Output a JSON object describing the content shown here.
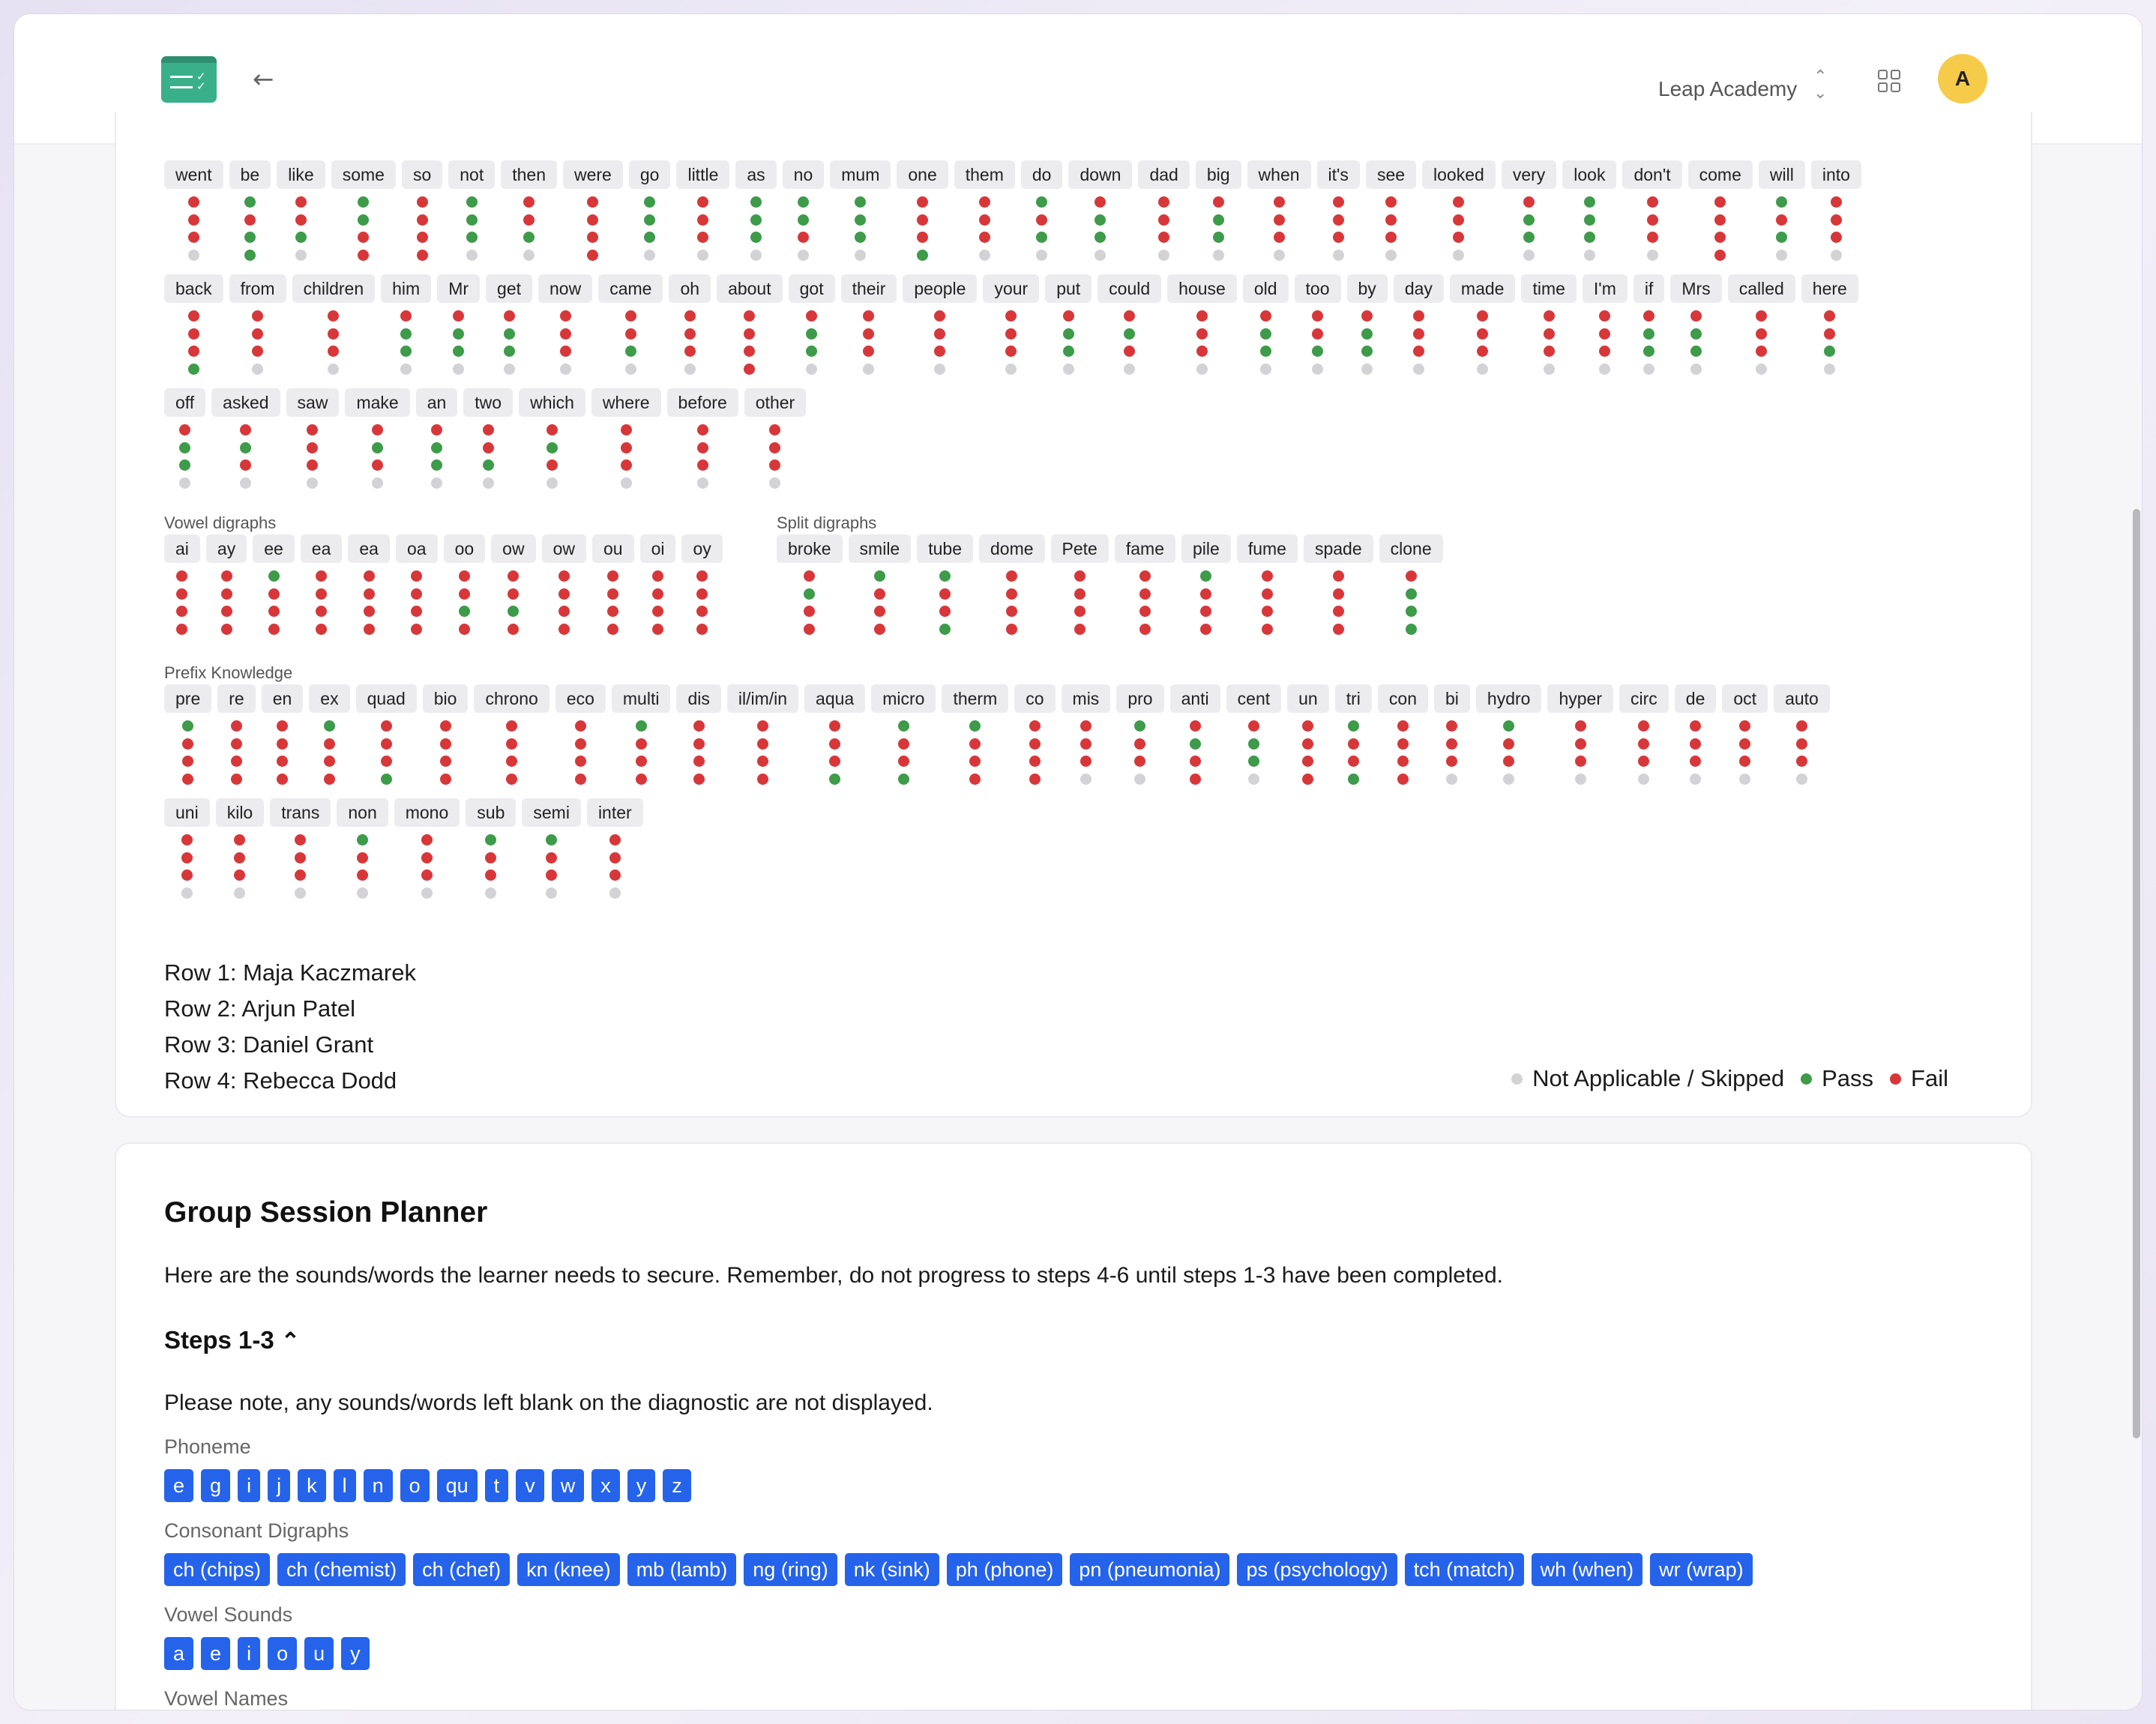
{
  "header": {
    "school_name": "Leap Academy",
    "avatar_initial": "A"
  },
  "keywords": {
    "rows": [
      {
        "words": [
          "went",
          "be",
          "like",
          "some",
          "so",
          "not",
          "then",
          "were",
          "go",
          "little",
          "as",
          "no",
          "mum",
          "one",
          "them",
          "do",
          "down",
          "dad",
          "big",
          "when",
          "it's",
          "see",
          "looked",
          "very",
          "look",
          "don't",
          "come",
          "will",
          "into"
        ],
        "results": [
          "FFFN",
          "PFPP",
          "FFPN",
          "PPFF",
          "FFFF",
          "PPPN",
          "FFPN",
          "FFFF",
          "PPPN",
          "FFFN",
          "PPPN",
          "PPFN",
          "PPPN",
          "FFFP",
          "FFFN",
          "PFPN",
          "FPPN",
          "FFFN",
          "FPPN",
          "FFFN",
          "FFFN",
          "FFFN",
          "FFFN",
          "FPPN",
          "PPPN",
          "FFFN",
          "FFFF",
          "PFPN",
          "FFFN"
        ]
      },
      {
        "words": [
          "back",
          "from",
          "children",
          "him",
          "Mr",
          "get",
          "now",
          "came",
          "oh",
          "about",
          "got",
          "their",
          "people",
          "your",
          "put",
          "could",
          "house",
          "old",
          "too",
          "by",
          "day",
          "made",
          "time",
          "I'm",
          "if",
          "Mrs",
          "called",
          "here"
        ],
        "results": [
          "FFFP",
          "FFFN",
          "FFFN",
          "FPPN",
          "FPPN",
          "FPPN",
          "FFFN",
          "FFPN",
          "FFFN",
          "FFFF",
          "FPPN",
          "FFFN",
          "FFFN",
          "FFFN",
          "FPPN",
          "FPFN",
          "FFFN",
          "FPPN",
          "FFPN",
          "FPPN",
          "FFFN",
          "FFFN",
          "FFFN",
          "FFFN",
          "FPPN",
          "FPPN",
          "FFFN",
          "FFPN"
        ]
      },
      {
        "words": [
          "off",
          "asked",
          "saw",
          "make",
          "an",
          "two",
          "which",
          "where",
          "before",
          "other"
        ],
        "results": [
          "FPPN",
          "FPFN",
          "FFFN",
          "FPFN",
          "FPPN",
          "FFPN",
          "FPFN",
          "FFFN",
          "FFFN",
          "FFFN"
        ]
      }
    ]
  },
  "vowel_digraphs": {
    "label": "Vowel digraphs",
    "words": [
      "ai",
      "ay",
      "ee",
      "ea",
      "ea",
      "oa",
      "oo",
      "ow",
      "ow",
      "ou",
      "oi",
      "oy"
    ],
    "results": [
      "FFFF",
      "FFFF",
      "PFFF",
      "FFFF",
      "FFFF",
      "FFFF",
      "FFPF",
      "FFPF",
      "FFFF",
      "FFFF",
      "FFFF",
      "FFFF"
    ]
  },
  "split_digraphs": {
    "label": "Split digraphs",
    "words": [
      "broke",
      "smile",
      "tube",
      "dome",
      "Pete",
      "fame",
      "pile",
      "fume",
      "spade",
      "clone"
    ],
    "results": [
      "FPFF",
      "PFFF",
      "PFFP",
      "FFFF",
      "FFFF",
      "FFFF",
      "PFFF",
      "FFFF",
      "FFFF",
      "FPPP"
    ]
  },
  "prefix": {
    "label": "Prefix Knowledge",
    "rows": [
      {
        "words": [
          "pre",
          "re",
          "en",
          "ex",
          "quad",
          "bio",
          "chrono",
          "eco",
          "multi",
          "dis",
          "il/im/in",
          "aqua",
          "micro",
          "therm",
          "co",
          "mis",
          "pro",
          "anti",
          "cent",
          "un",
          "tri",
          "con",
          "bi",
          "hydro",
          "hyper",
          "circ",
          "de",
          "oct",
          "auto"
        ],
        "results": [
          "PFFF",
          "FFFF",
          "FFFF",
          "PFFF",
          "FFFP",
          "FFFF",
          "FFFF",
          "FFFF",
          "PFFF",
          "FFFF",
          "FFFF",
          "FFFP",
          "PFFP",
          "PFFF",
          "FFFF",
          "FFFN",
          "PFFN",
          "FPFF",
          "FPPN",
          "FFFF",
          "PFFP",
          "FFFF",
          "FFFN",
          "PFFN",
          "FFFN",
          "FFFN",
          "FFFN",
          "FFFN",
          "FFFN"
        ]
      },
      {
        "words": [
          "uni",
          "kilo",
          "trans",
          "non",
          "mono",
          "sub",
          "semi",
          "inter"
        ],
        "results": [
          "FFFN",
          "FFFN",
          "FFFN",
          "PFFN",
          "FFFN",
          "PFFN",
          "PFFN",
          "FFFN"
        ]
      }
    ]
  },
  "students": [
    "Row 1: Maja Kaczmarek",
    "Row 2: Arjun Patel",
    "Row 3: Daniel Grant",
    "Row 4: Rebecca Dodd"
  ],
  "legend": {
    "na": "Not Applicable / Skipped",
    "pass": "Pass",
    "fail": "Fail",
    "colors": {
      "na": "#d3d3d6",
      "pass": "#3d9b4a",
      "fail": "#d8373a"
    }
  },
  "planner": {
    "title": "Group Session Planner",
    "intro": "Here are the sounds/words the learner needs to secure. Remember, do not progress to steps 4-6 until steps 1-3 have been completed.",
    "steps_label": "Steps 1-3",
    "note": "Please note, any sounds/words left blank on the diagnostic are not displayed.",
    "phoneme_label": "Phoneme",
    "phonemes": [
      "e",
      "g",
      "i",
      "j",
      "k",
      "l",
      "n",
      "o",
      "qu",
      "t",
      "v",
      "w",
      "x",
      "y",
      "z"
    ],
    "consonant_label": "Consonant Digraphs",
    "consonants": [
      "ch (chips)",
      "ch (chemist)",
      "ch (chef)",
      "kn (knee)",
      "mb (lamb)",
      "ng (ring)",
      "nk (sink)",
      "ph (phone)",
      "pn (pneumonia)",
      "ps (psychology)",
      "tch (match)",
      "wh (when)",
      "wr (wrap)"
    ],
    "vowel_sounds_label": "Vowel Sounds",
    "vowel_sounds": [
      "a",
      "e",
      "i",
      "o",
      "u",
      "y"
    ],
    "vowel_names_label": "Vowel Names"
  }
}
